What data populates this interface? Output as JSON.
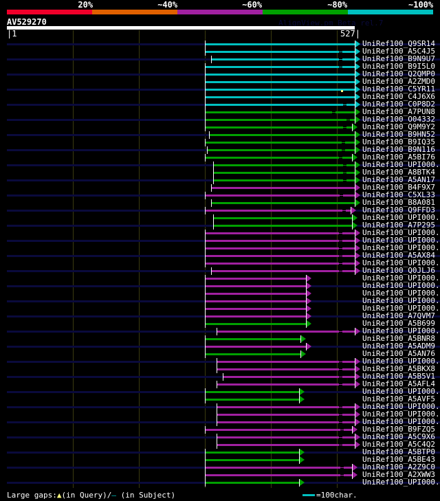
{
  "colors": {
    "red": "#f0002a",
    "orange": "#e06000",
    "magenta": "#a020a0",
    "green": "#00a000",
    "cyan": "#00c0c0",
    "stripe": "#0a0a3c"
  },
  "scale": [
    {
      "label": "20%",
      "color": "#f0002a"
    },
    {
      "label": "~40%",
      "color": "#e06000"
    },
    {
      "label": "~60%",
      "color": "#a020a0"
    },
    {
      "label": "~80%",
      "color": "#00a000"
    },
    {
      "label": "~100%",
      "color": "#00c0c0"
    }
  ],
  "query": {
    "name": "AV529270",
    "start": "1",
    "end": "527",
    "length": 527
  },
  "watermark": "AlignView.pm Beta rel.7",
  "grid_residues": [
    100,
    200,
    300,
    400,
    500
  ],
  "hits": [
    {
      "label": "UniRef100_Q9SR14",
      "start": 300,
      "end": 527,
      "color": "cyan"
    },
    {
      "label": "UniRef100_A5C4J5",
      "start": 300,
      "end": 527,
      "color": "cyan",
      "gap": 503
    },
    {
      "label": "UniRef100_B9N9U7",
      "start": 309,
      "end": 527,
      "color": "cyan",
      "gap": 503
    },
    {
      "label": "UniRef100_B9I5L0",
      "start": 300,
      "end": 527,
      "color": "cyan",
      "gap": 503
    },
    {
      "label": "UniRef100_Q2QMP0",
      "start": 300,
      "end": 527,
      "color": "cyan"
    },
    {
      "label": "UniRef100_A2ZMD0",
      "start": 300,
      "end": 527,
      "color": "cyan"
    },
    {
      "label": "UniRef100_C5YR11",
      "start": 300,
      "end": 527,
      "color": "cyan",
      "qgap": 506
    },
    {
      "label": "UniRef100_C4J6X6",
      "start": 300,
      "end": 527,
      "color": "cyan"
    },
    {
      "label": "UniRef100_C0P8D2",
      "start": 300,
      "end": 527,
      "color": "cyan",
      "gap": 509
    },
    {
      "label": "UniRef100_A7PUN8",
      "start": 300,
      "end": 527,
      "color": "green",
      "gap": 493
    },
    {
      "label": "UniRef100_O04332",
      "start": 300,
      "end": 527,
      "color": "green",
      "gap": 514
    },
    {
      "label": "UniRef100_Q9M9Y2",
      "start": 300,
      "end": 523,
      "color": "green",
      "gap": 509
    },
    {
      "label": "UniRef100_B9HN52",
      "start": 306,
      "end": 527,
      "color": "green"
    },
    {
      "label": "UniRef100_B9IQ35",
      "start": 300,
      "end": 527,
      "color": "green",
      "gap": 507
    },
    {
      "label": "UniRef100_B9N116",
      "start": 303,
      "end": 527,
      "color": "green",
      "gap": 507
    },
    {
      "label": "UniRef100_A5BI76",
      "start": 300,
      "end": 523,
      "color": "green",
      "gap": 503
    },
    {
      "label": "UniRef100_UPI000..",
      "start": 312,
      "end": 527,
      "color": "green",
      "gap": 509
    },
    {
      "label": "UniRef100_A8BTK4",
      "start": 312,
      "end": 527,
      "color": "green",
      "gap": 509
    },
    {
      "label": "UniRef100_A5AN17",
      "start": 312,
      "end": 527,
      "color": "green",
      "gap": 509
    },
    {
      "label": "UniRef100_B4F9X7",
      "start": 309,
      "end": 527,
      "color": "magenta"
    },
    {
      "label": "UniRef100_C5XL33",
      "start": 300,
      "end": 527,
      "color": "magenta",
      "gap": 504
    },
    {
      "label": "UniRef100_B8A081",
      "start": 309,
      "end": 527,
      "color": "green"
    },
    {
      "label": "UniRef100_Q9FFD3",
      "start": 300,
      "end": 521,
      "color": "magenta",
      "gap": 508
    },
    {
      "label": "UniRef100_UPI000..",
      "start": 312,
      "end": 523,
      "color": "green"
    },
    {
      "label": "UniRef100_A7P295",
      "start": 312,
      "end": 523,
      "color": "green"
    },
    {
      "label": "UniRef100_UPI000..",
      "start": 300,
      "end": 527,
      "color": "magenta",
      "gap": 503
    },
    {
      "label": "UniRef100_UPI000..",
      "start": 300,
      "end": 527,
      "color": "magenta",
      "gap": 503
    },
    {
      "label": "UniRef100_UPI000..",
      "start": 300,
      "end": 527,
      "color": "magenta",
      "gap": 503
    },
    {
      "label": "UniRef100_A5AX84",
      "start": 300,
      "end": 527,
      "color": "magenta",
      "gap": 503
    },
    {
      "label": "UniRef100_UPI000..",
      "start": 300,
      "end": 527,
      "color": "magenta",
      "gap": 503
    },
    {
      "label": "UniRef100_Q0JLJ6",
      "start": 309,
      "end": 527,
      "color": "magenta",
      "gap": 503
    },
    {
      "label": "UniRef100_UPI000..",
      "start": 300,
      "end": 453,
      "color": "magenta"
    },
    {
      "label": "UniRef100_UPI000..",
      "start": 300,
      "end": 453,
      "color": "magenta"
    },
    {
      "label": "UniRef100_UPI000..",
      "start": 300,
      "end": 453,
      "color": "magenta"
    },
    {
      "label": "UniRef100_UPI000..",
      "start": 300,
      "end": 453,
      "color": "magenta"
    },
    {
      "label": "UniRef100_UPI000..",
      "start": 300,
      "end": 453,
      "color": "magenta"
    },
    {
      "label": "UniRef100_A7QVM7",
      "start": 300,
      "end": 453,
      "color": "magenta"
    },
    {
      "label": "UniRef100_A5B699",
      "start": 300,
      "end": 453,
      "color": "green"
    },
    {
      "label": "UniRef100_UPI000..",
      "start": 318,
      "end": 527,
      "color": "magenta",
      "gap": 503
    },
    {
      "label": "UniRef100_A5BNR8",
      "start": 300,
      "end": 445,
      "color": "green"
    },
    {
      "label": "UniRef100_A5ADM9",
      "start": 300,
      "end": 453,
      "color": "magenta"
    },
    {
      "label": "UniRef100_A5AN76",
      "start": 300,
      "end": 445,
      "color": "green"
    },
    {
      "label": "UniRef100_UPI000..",
      "start": 318,
      "end": 527,
      "color": "magenta",
      "gap": 503
    },
    {
      "label": "UniRef100_A5BKX8",
      "start": 318,
      "end": 527,
      "color": "magenta",
      "gap": 503
    },
    {
      "label": "UniRef100_A5B5V1",
      "start": 327,
      "end": 527,
      "color": "magenta",
      "gap": 503
    },
    {
      "label": "UniRef100_A5AFL4",
      "start": 318,
      "end": 527,
      "color": "magenta",
      "gap": 503
    },
    {
      "label": "UniRef100_UPI000..",
      "start": 300,
      "end": 443,
      "color": "green"
    },
    {
      "label": "UniRef100_A5AVF5",
      "start": 300,
      "end": 443,
      "color": "green"
    },
    {
      "label": "UniRef100_UPI000..",
      "start": 318,
      "end": 527,
      "color": "magenta",
      "gap": 503
    },
    {
      "label": "UniRef100_UPI000..",
      "start": 318,
      "end": 527,
      "color": "magenta",
      "gap": 503
    },
    {
      "label": "UniRef100_UPI000..",
      "start": 318,
      "end": 527,
      "color": "magenta",
      "gap": 503
    },
    {
      "label": "UniRef100_B9FZQ5",
      "start": 300,
      "end": 523,
      "color": "magenta",
      "gap": 505
    },
    {
      "label": "UniRef100_A5C9X6",
      "start": 318,
      "end": 527,
      "color": "magenta",
      "gap": 503
    },
    {
      "label": "UniRef100_A5C4Q2",
      "start": 318,
      "end": 527,
      "color": "magenta",
      "gap": 503
    },
    {
      "label": "UniRef100_A5BTP0",
      "start": 300,
      "end": 443,
      "color": "green"
    },
    {
      "label": "UniRef100_A5BE43",
      "start": 300,
      "end": 443,
      "color": "green"
    },
    {
      "label": "UniRef100_A2Z9C0",
      "start": 300,
      "end": 523,
      "color": "magenta",
      "gap": 505
    },
    {
      "label": "UniRef100_A2XWW3",
      "start": 300,
      "end": 523,
      "color": "magenta",
      "gap": 505
    },
    {
      "label": "UniRef100_UPI000..",
      "start": 300,
      "end": 443,
      "color": "green"
    }
  ],
  "footer": {
    "large_gaps": "Large gaps:",
    "in_query": "(in Query)/",
    "in_subject": " (in Subject)",
    "legend": "=100char."
  }
}
